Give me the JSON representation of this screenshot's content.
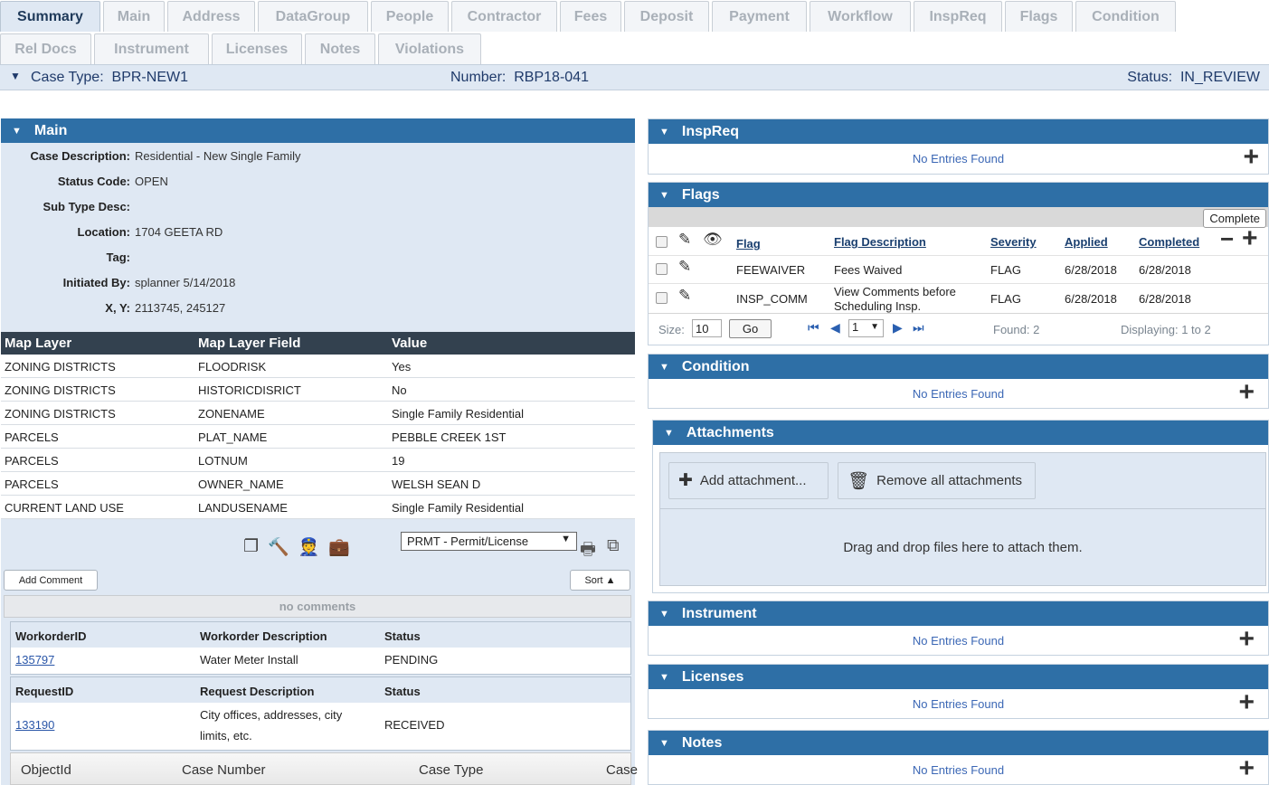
{
  "tabs_row1": [
    {
      "label": "Summary",
      "active": true
    },
    {
      "label": "Main"
    },
    {
      "label": "Address"
    },
    {
      "label": "DataGroup"
    },
    {
      "label": "People"
    },
    {
      "label": "Contractor"
    },
    {
      "label": "Fees"
    },
    {
      "label": "Deposit"
    },
    {
      "label": "Payment"
    },
    {
      "label": "Workflow"
    },
    {
      "label": "InspReq"
    },
    {
      "label": "Flags"
    },
    {
      "label": "Condition"
    }
  ],
  "tabs_row2": [
    {
      "label": "Rel Docs"
    },
    {
      "label": "Instrument"
    },
    {
      "label": "Licenses"
    },
    {
      "label": "Notes"
    },
    {
      "label": "Violations"
    }
  ],
  "casebar": {
    "case_type_label": "Case Type:",
    "case_type": "BPR-NEW1",
    "number_label": "Number:",
    "number": "RBP18-041",
    "status_label": "Status:",
    "status": "IN_REVIEW"
  },
  "main": {
    "title": "Main",
    "fields": [
      {
        "label": "Case Description:",
        "value": "Residential - New Single Family"
      },
      {
        "label": "Status Code:",
        "value": "OPEN"
      },
      {
        "label": "Sub Type Desc:",
        "value": ""
      },
      {
        "label": "Location:",
        "value": "1704 GEETA RD"
      },
      {
        "label": "Tag:",
        "value": ""
      },
      {
        "label": "Initiated By:",
        "value": "splanner 5/14/2018"
      },
      {
        "label": "X, Y:",
        "value": "2113745, 245127"
      }
    ],
    "map_headers": [
      "Map Layer",
      "Map Layer Field",
      "Value"
    ],
    "map_rows": [
      [
        "ZONING DISTRICTS",
        "FLOODRISK",
        "Yes"
      ],
      [
        "ZONING DISTRICTS",
        "HISTORICDISRICT",
        "No"
      ],
      [
        "ZONING DISTRICTS",
        "ZONENAME",
        "Single Family Residential"
      ],
      [
        "PARCELS",
        "PLAT_NAME",
        "PEBBLE CREEK 1ST"
      ],
      [
        "PARCELS",
        "LOTNUM",
        "19"
      ],
      [
        "PARCELS",
        "OWNER_NAME",
        "WELSH SEAN D"
      ],
      [
        "CURRENT LAND USE",
        "LANDUSENAME",
        "Single Family Residential"
      ]
    ],
    "module_select": "PRMT - Permit/License",
    "add_comment": "Add Comment",
    "sort": "Sort ▲",
    "no_comments": "no comments",
    "workorders": {
      "headers": [
        "WorkorderID",
        "Workorder Description",
        "Status"
      ],
      "row": [
        "135797",
        "Water Meter Install",
        "PENDING"
      ]
    },
    "requests": {
      "headers": [
        "RequestID",
        "Request Description",
        "Status"
      ],
      "row": [
        "133190",
        "City offices, addresses, city",
        "limits, etc.",
        "RECEIVED"
      ]
    },
    "object_headers": [
      "ObjectId",
      "Case Number",
      "Case Type",
      "Case"
    ]
  },
  "inspreq": {
    "title": "InspReq",
    "empty": "No Entries Found"
  },
  "flags": {
    "title": "Flags",
    "complete": "Complete",
    "headers": [
      "Flag",
      "Flag Description",
      "Severity",
      "Applied",
      "Completed"
    ],
    "rows": [
      {
        "flag": "FEEWAIVER",
        "desc1": "Fees Waived",
        "desc2": "",
        "severity": "FLAG",
        "applied": "6/28/2018",
        "completed": "6/28/2018"
      },
      {
        "flag": "INSP_COMM",
        "desc1": "View Comments before",
        "desc2": "Scheduling Insp.",
        "severity": "FLAG",
        "applied": "6/28/2018",
        "completed": "6/28/2018"
      }
    ],
    "size_label": "Size:",
    "size": "10",
    "go": "Go",
    "page": "1",
    "found": "Found: 2",
    "displaying": "Displaying: 1 to 2"
  },
  "condition": {
    "title": "Condition",
    "empty": "No Entries Found"
  },
  "attachments": {
    "title": "Attachments",
    "add": "Add attachment...",
    "remove": "Remove all attachments",
    "drop": "Drag and drop files here to attach them."
  },
  "instrument": {
    "title": "Instrument",
    "empty": "No Entries Found"
  },
  "licenses": {
    "title": "Licenses",
    "empty": "No Entries Found"
  },
  "notes": {
    "title": "Notes",
    "empty": "No Entries Found"
  }
}
